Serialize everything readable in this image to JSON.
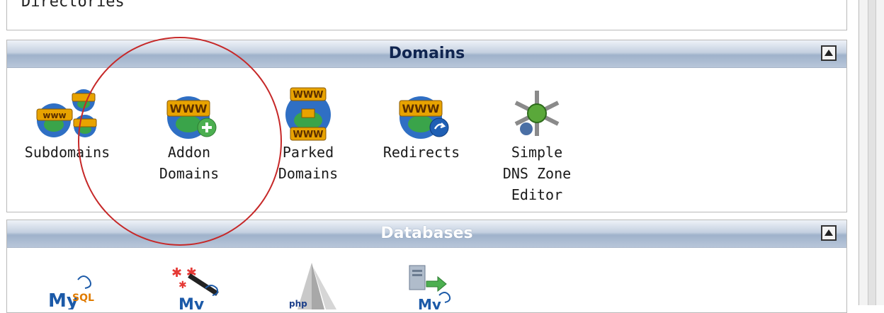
{
  "previous_section": {
    "partial_text": "Directories"
  },
  "domains": {
    "title": "Domains",
    "items": [
      {
        "label": "Subdomains",
        "icon": "subdomains-icon"
      },
      {
        "label": "Addon\nDomains",
        "icon": "addon-domains-icon"
      },
      {
        "label": "Parked\nDomains",
        "icon": "parked-domains-icon"
      },
      {
        "label": "Redirects",
        "icon": "redirects-icon"
      },
      {
        "label": "Simple\nDNS Zone\nEditor",
        "icon": "dns-zone-editor-icon"
      }
    ]
  },
  "databases": {
    "title": "Databases",
    "items": [
      {
        "label": "",
        "icon": "mysql-databases-icon"
      },
      {
        "label": "",
        "icon": "mysql-wizard-icon"
      },
      {
        "label": "",
        "icon": "phpmyadmin-icon"
      },
      {
        "label": "",
        "icon": "remote-mysql-icon"
      }
    ]
  },
  "colors": {
    "header_text": "#102550",
    "highlight_circle": "#c62828",
    "www_gold": "#e8a300",
    "globe_blue": "#2f6fc4"
  }
}
